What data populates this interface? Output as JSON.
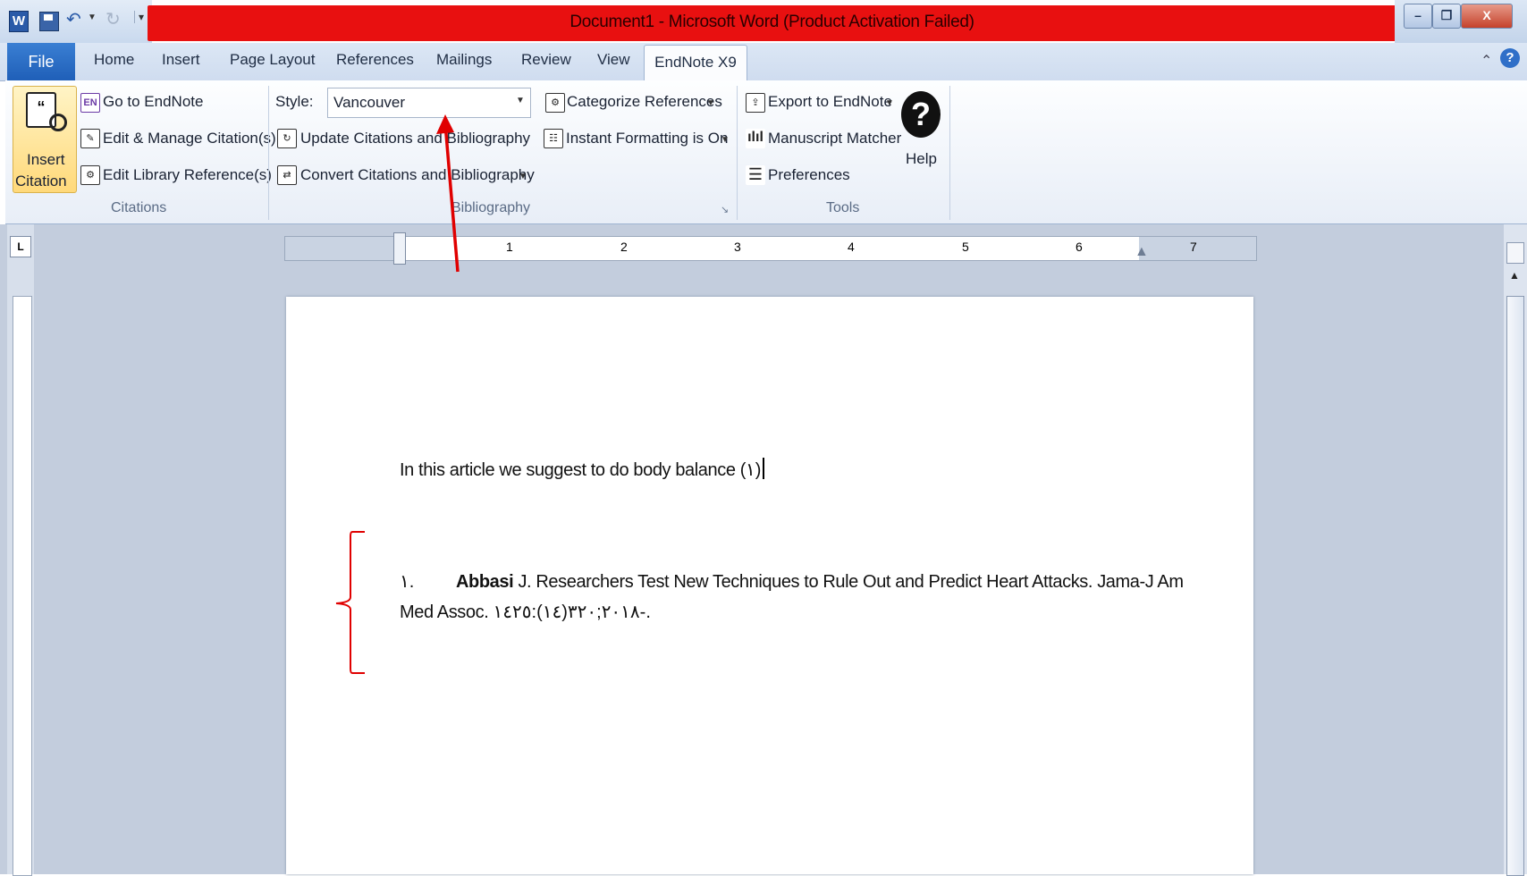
{
  "window": {
    "title": "Document1  -  Microsoft Word (Product Activation Failed)",
    "app_icon": "W",
    "controls": {
      "minimize": "–",
      "restore": "❐",
      "close": "X"
    }
  },
  "tabs": {
    "file": "File",
    "items": [
      "Home",
      "Insert",
      "Page Layout",
      "References",
      "Mailings",
      "Review",
      "View"
    ],
    "active": "EndNote X9"
  },
  "ribbon": {
    "citations": {
      "insert_label_1": "Insert",
      "insert_label_2": "Citation",
      "go_to": "Go to EndNote",
      "edit_manage": "Edit & Manage Citation(s)",
      "edit_library": "Edit Library Reference(s)",
      "group_label": "Citations"
    },
    "bibliography": {
      "style_label": "Style:",
      "style_value": "Vancouver",
      "update": "Update Citations and Bibliography",
      "convert": "Convert Citations and Bibliography",
      "categorize": "Categorize References",
      "instant": "Instant Formatting is On",
      "group_label": "Bibliography"
    },
    "tools": {
      "export": "Export to EndNote",
      "manuscript": "Manuscript Matcher",
      "preferences": "Preferences",
      "help": "Help",
      "group_label": "Tools"
    }
  },
  "ruler": {
    "numbers": [
      "1",
      "2",
      "3",
      "4",
      "5",
      "6",
      "7"
    ]
  },
  "document": {
    "sentence": "In this article we suggest to do body balance (١)",
    "ref_number": "١.",
    "ref_author": "Abbasi",
    "ref_line1": " J. Researchers Test New Techniques to Rule Out and Predict Heart Attacks. Jama-J Am",
    "ref_line2": "Med Assoc. ٢٠١٨;٣٢٠(١٤):١٤٢٥-."
  },
  "annotation_colors": {
    "arrow": "#e00000",
    "brace": "#e00000",
    "titlebar": "#e81010"
  }
}
